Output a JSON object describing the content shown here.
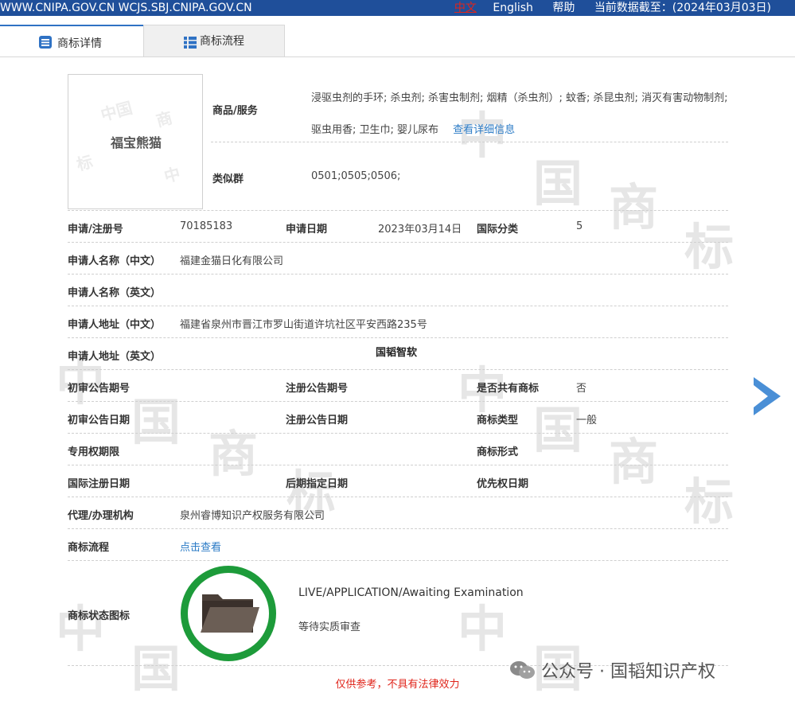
{
  "topbar": {
    "site": "WWW.CNIPA.GOV.CN WCJS.SBJ.CNIPA.GOV.CN",
    "lang_zh": "中文",
    "lang_en": "English",
    "help": "帮助",
    "data_date": "当前数据截至：(2024年03月03日)"
  },
  "tabs": {
    "detail": "商标详情",
    "flow": "商标流程"
  },
  "watermark": {
    "chars": [
      "中",
      "国",
      "商",
      "标"
    ]
  },
  "mark_image": {
    "text": "福宝熊猫"
  },
  "goods": {
    "label": "商品/服务",
    "value": "浸驱虫剂的手环; 杀虫剂; 杀害虫制剂; 烟精（杀虫剂）; 蚊香; 杀昆虫剂; 消灭有害动物制剂; 驱虫用香; 卫生巾; 婴儿尿布",
    "more_link": "查看详细信息"
  },
  "similar_group": {
    "label": "类似群",
    "value": "0501;0505;0506;"
  },
  "reg_no": {
    "label": "申请/注册号",
    "value": "70185183"
  },
  "apply_date": {
    "label": "申请日期",
    "value": "2023年03月14日"
  },
  "intl_class": {
    "label": "国际分类",
    "value": "5"
  },
  "applicant_cn": {
    "label": "申请人名称（中文）",
    "value": "福建金猫日化有限公司"
  },
  "applicant_en": {
    "label": "申请人名称（英文）",
    "value": ""
  },
  "address_cn": {
    "label": "申请人地址（中文）",
    "value": "福建省泉州市晋江市罗山街道许坑社区平安西路235号"
  },
  "address_en": {
    "label": "申请人地址（英文）",
    "value": ""
  },
  "overlay_text": "国韬智软",
  "prelim_no": {
    "label": "初审公告期号",
    "value": ""
  },
  "reg_pub_no": {
    "label": "注册公告期号",
    "value": ""
  },
  "shared": {
    "label": "是否共有商标",
    "value": "否"
  },
  "prelim_date": {
    "label": "初审公告日期",
    "value": ""
  },
  "reg_pub_date": {
    "label": "注册公告日期",
    "value": ""
  },
  "mark_type": {
    "label": "商标类型",
    "value": "一般"
  },
  "exclusive_period": {
    "label": "专用权期限",
    "value": ""
  },
  "mark_form": {
    "label": "商标形式",
    "value": ""
  },
  "intl_reg_date": {
    "label": "国际注册日期",
    "value": ""
  },
  "later_date": {
    "label": "后期指定日期",
    "value": ""
  },
  "priority_date": {
    "label": "优先权日期",
    "value": ""
  },
  "agency": {
    "label": "代理/办理机构",
    "value": "泉州睿博知识产权服务有限公司"
  },
  "flow": {
    "label": "商标流程",
    "link": "点击查看"
  },
  "status": {
    "label": "商标状态图标",
    "en": "LIVE/APPLICATION/Awaiting Examination",
    "cn": "等待实质审查",
    "icon": "folder-icon",
    "ring_color": "#1d9b3a"
  },
  "footer": {
    "disclaimer": "仅供参考，不具有法律效力",
    "wechat": "公众号 · 国韬知识产权"
  },
  "colors": {
    "topbar": "#1f4f9a",
    "accent": "#2f72c4",
    "link": "#2b7bc6",
    "warn": "#e0251b"
  }
}
